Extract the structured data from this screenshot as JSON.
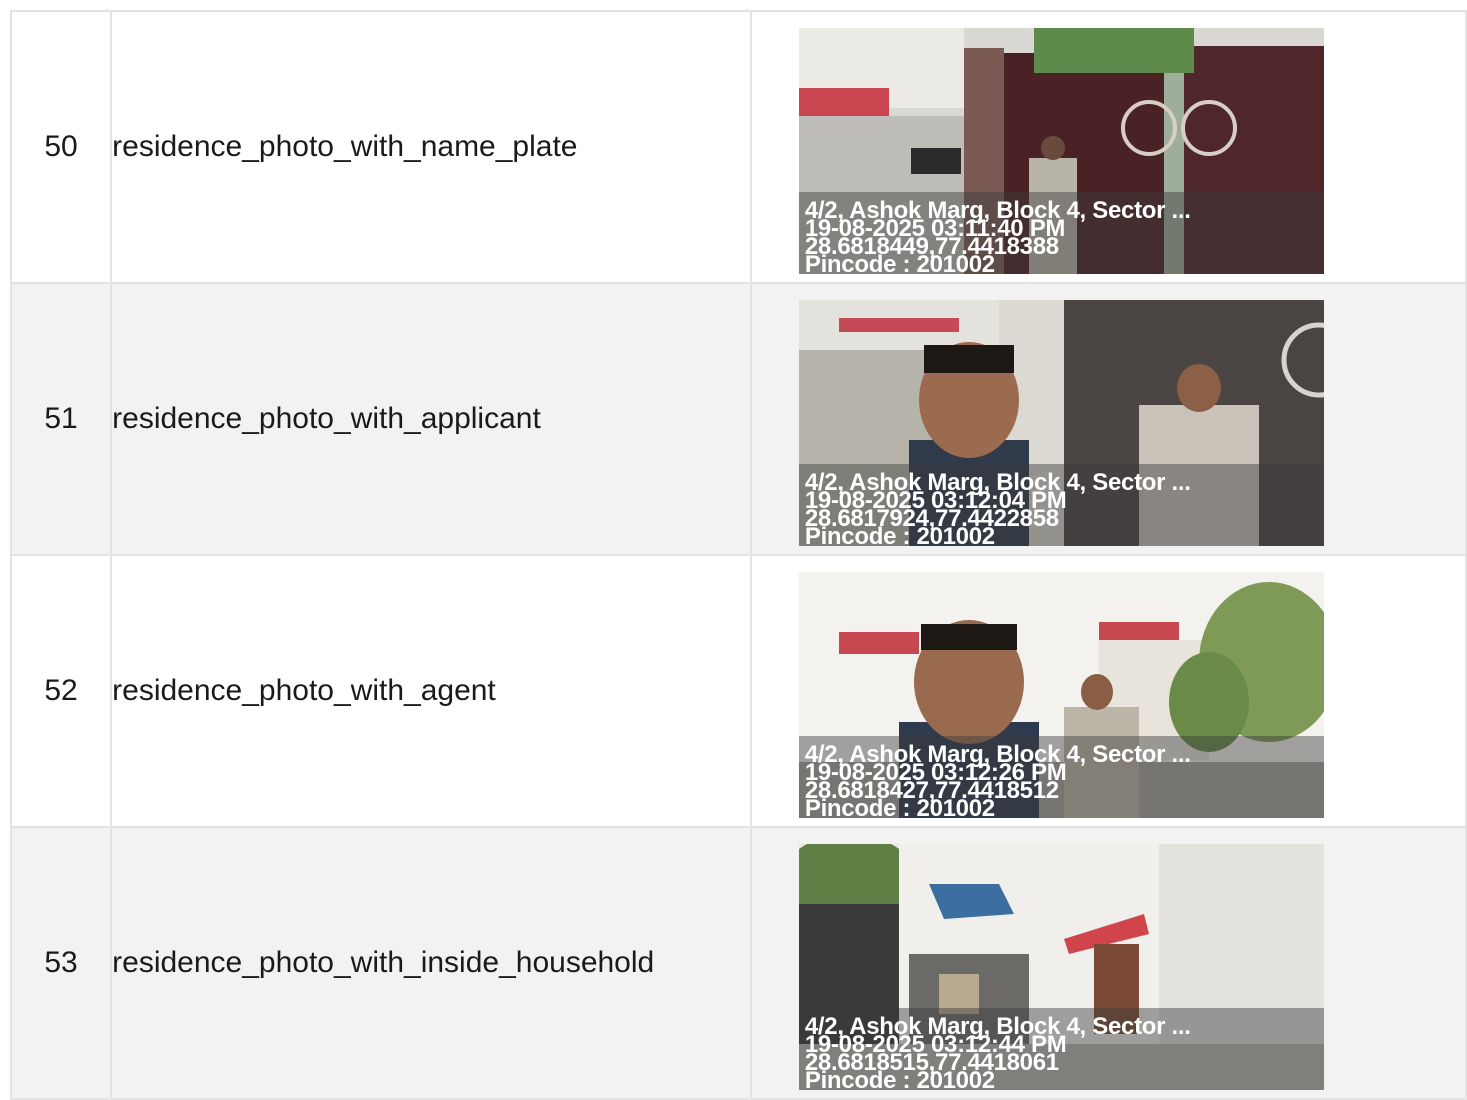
{
  "rows": [
    {
      "number": "50",
      "label": "residence_photo_with_name_plate",
      "stamp": {
        "address": "4/2, Ashok Marg, Block 4, Sector ...",
        "datetime": "19-08-2025 03:11:40 PM",
        "coords": "28.6818449,77.4418388",
        "pincode": "Pincode : 201002"
      }
    },
    {
      "number": "51",
      "label": "residence_photo_with_applicant",
      "stamp": {
        "address": "4/2, Ashok Marg, Block 4, Sector ...",
        "datetime": "19-08-2025 03:12:04 PM",
        "coords": "28.6817924,77.4422858",
        "pincode": "Pincode : 201002"
      }
    },
    {
      "number": "52",
      "label": "residence_photo_with_agent",
      "stamp": {
        "address": "4/2, Ashok Marg, Block 4, Sector ...",
        "datetime": "19-08-2025 03:12:26 PM",
        "coords": "28.6818427,77.4418512",
        "pincode": "Pincode : 201002"
      }
    },
    {
      "number": "53",
      "label": "residence_photo_with_inside_household",
      "stamp": {
        "address": "4/2, Ashok Marg, Block 4, Sector ...",
        "datetime": "19-08-2025 03:12:44 PM",
        "coords": "28.6818515,77.4418061",
        "pincode": "Pincode : 201002"
      }
    }
  ]
}
